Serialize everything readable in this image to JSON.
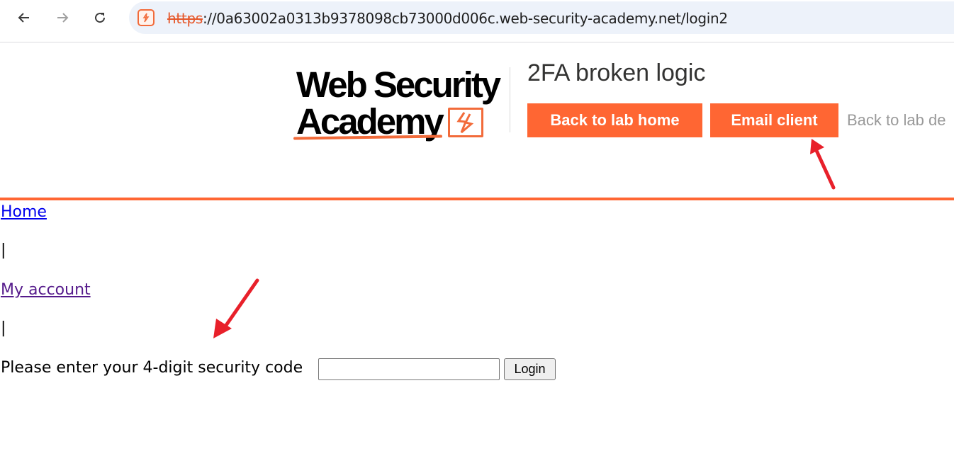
{
  "browser": {
    "url_scheme": "https",
    "url_rest": "://0a63002a0313b9378098cb73000d006c.web-security-academy.net/login2"
  },
  "header": {
    "logo_line1": "Web Security",
    "logo_line2": "Academy",
    "lab_title": "2FA broken logic",
    "back_to_lab_home": "Back to lab home",
    "email_client": "Email client",
    "back_to_lab_description": "Back to lab de"
  },
  "nav": {
    "home": "Home",
    "separator": "|",
    "my_account": "My account"
  },
  "form": {
    "prompt": "Please enter your 4-digit security code",
    "code_value": "",
    "submit_label": "Login"
  },
  "colors": {
    "accent": "#ff6633",
    "annotation_arrow": "#e8202a"
  },
  "icons": {
    "back": "arrow-left-icon",
    "forward": "arrow-right-icon",
    "reload": "reload-icon",
    "site": "lightning-icon"
  }
}
